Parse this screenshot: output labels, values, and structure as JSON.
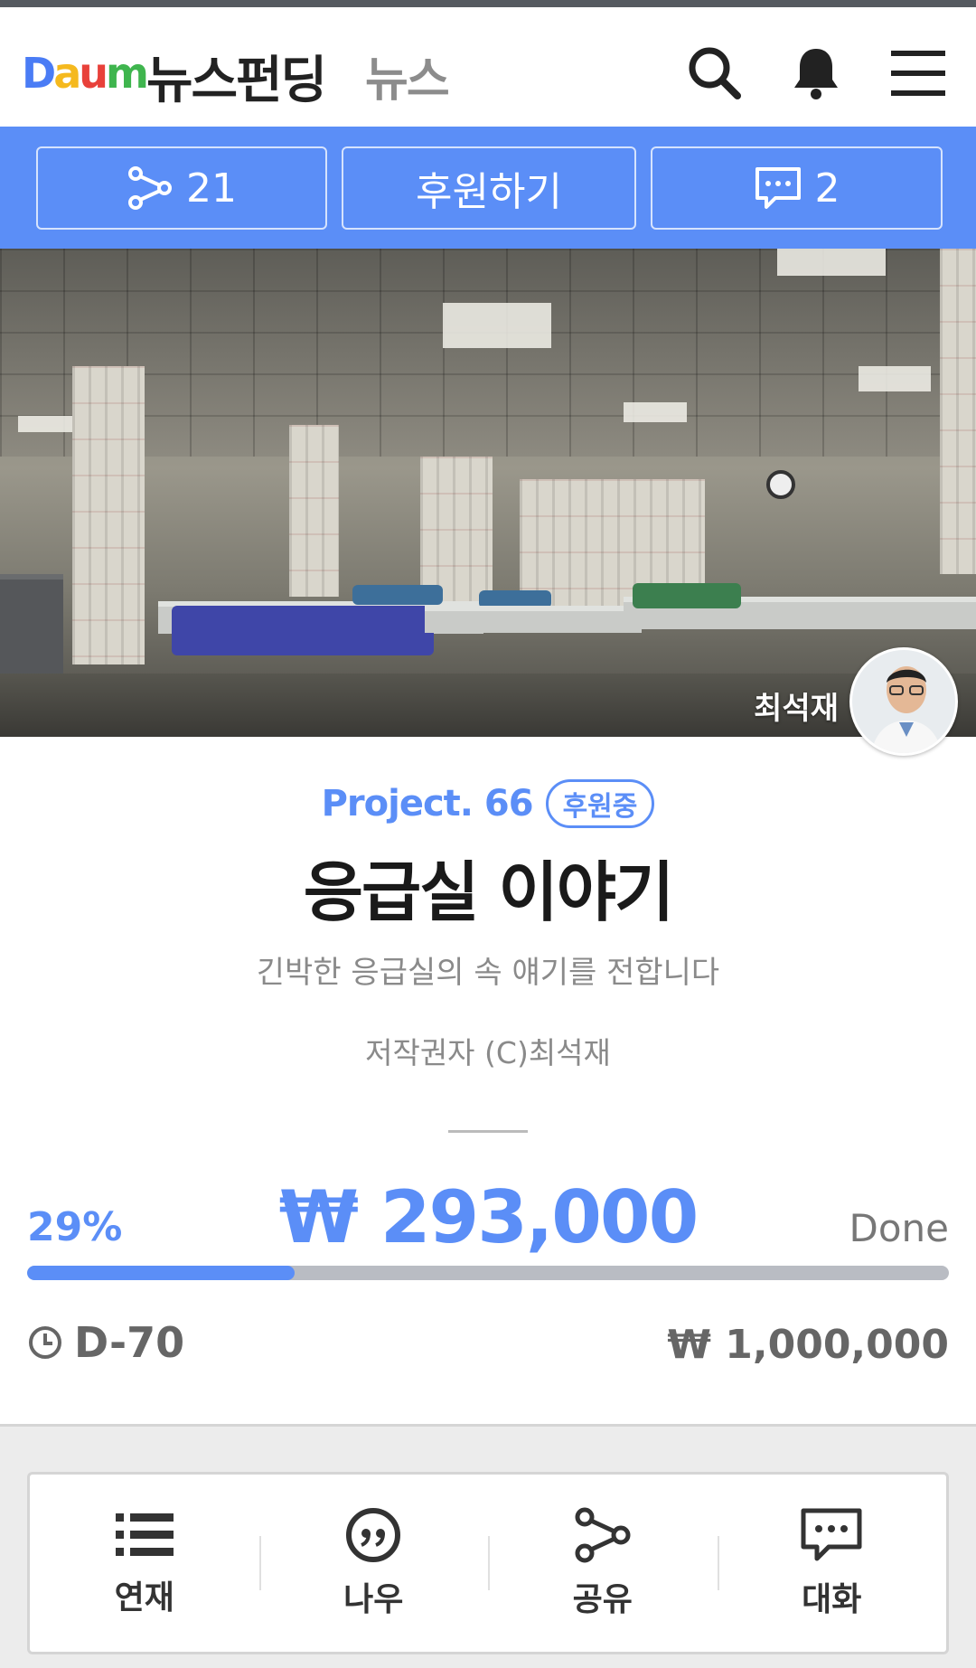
{
  "header": {
    "logo": "Daum",
    "title": "뉴스펀딩",
    "subtitle": "뉴스"
  },
  "actions": {
    "share_count": "21",
    "support_label": "후원하기",
    "comment_count": "2"
  },
  "hero": {
    "author": "최석재"
  },
  "project": {
    "label": "Project. 66",
    "status_badge": "후원중",
    "title": "응급실 이야기",
    "description": "긴박한 응급실의 속 얘기를 전합니다",
    "copyright": "저작권자 (C)최석재"
  },
  "funding": {
    "percent_text": "29%",
    "progress": 0.29,
    "amount": "₩ 293,000",
    "status": "Done",
    "days_left": "D-70",
    "goal": "₩ 1,000,000"
  },
  "bottom_nav": {
    "items": [
      {
        "label": "연재",
        "icon": "list-icon"
      },
      {
        "label": "나우",
        "icon": "quote-icon"
      },
      {
        "label": "공유",
        "icon": "share-icon"
      },
      {
        "label": "대화",
        "icon": "chat-icon"
      }
    ]
  },
  "colors": {
    "accent": "#5b8ef7",
    "title": "#1a1a1a",
    "muted": "#8a8a8a",
    "track": "#b9bcc3"
  }
}
